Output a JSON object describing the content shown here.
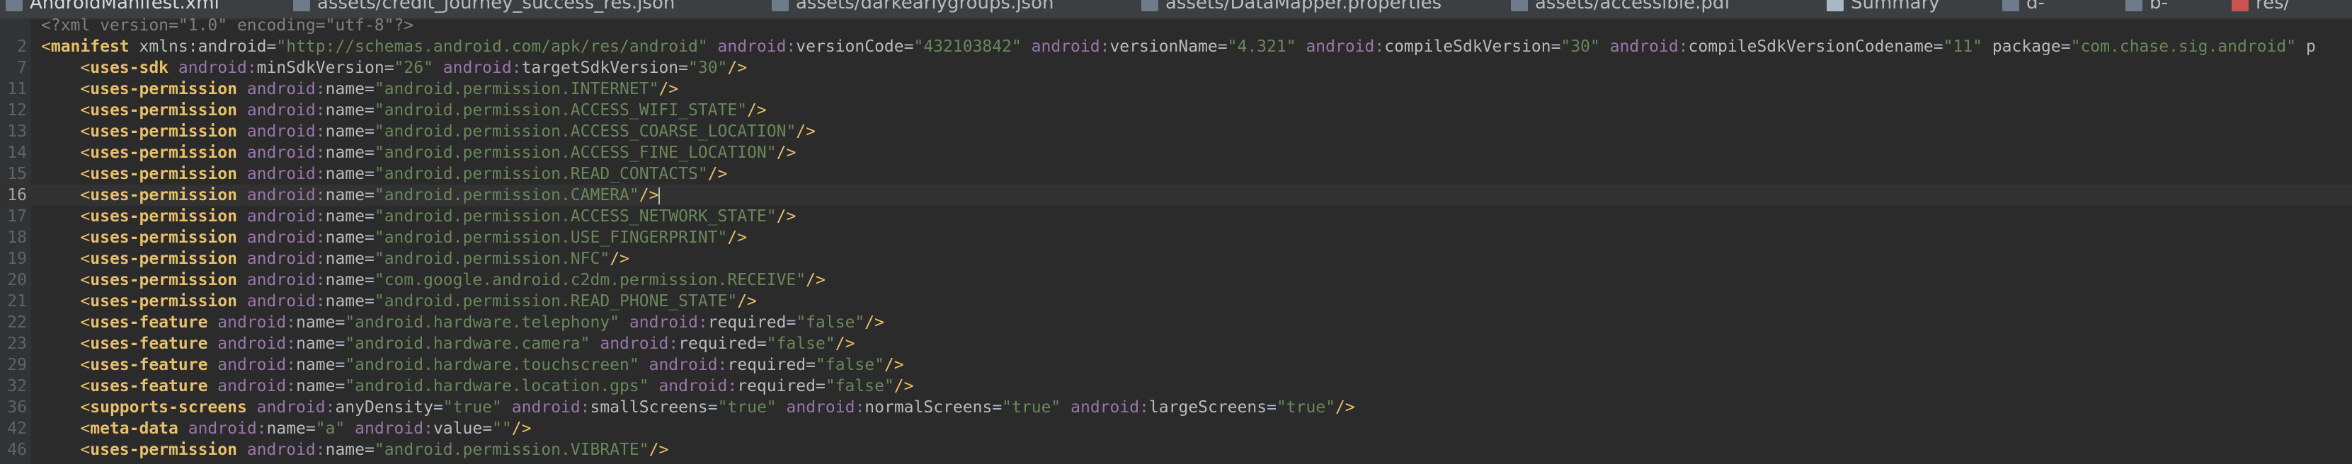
{
  "tabs": [
    {
      "label": "AndroidManifest.xml",
      "icon": "xml-file-icon",
      "active": true
    },
    {
      "label": "assets/credit_journey_success_res.json",
      "icon": "json-file-icon"
    },
    {
      "label": "assets/darkearlygroups.json",
      "icon": "json-file-icon"
    },
    {
      "label": "assets/DataMapper.properties",
      "icon": "properties-file-icon"
    },
    {
      "label": "assets/accessible.pdf",
      "icon": "pdf-file-icon"
    },
    {
      "label": "Summary",
      "icon": "summary-icon"
    },
    {
      "label": "d-",
      "icon": "file-icon"
    },
    {
      "label": "b-",
      "icon": "file-icon"
    },
    {
      "label": "res/",
      "icon": "res-folder-icon"
    }
  ],
  "lines": [
    {
      "num": "",
      "tokens": [
        [
          "decl",
          "<?xml version=\"1.0\" encoding=\"utf-8\"?>"
        ]
      ]
    },
    {
      "num": "2",
      "tokens": [
        [
          "brk",
          "<"
        ],
        [
          "tag",
          "manifest"
        ],
        [
          "txt",
          " "
        ],
        [
          "attr",
          "xmlns:android"
        ],
        [
          "eq",
          "="
        ],
        [
          "val",
          "\"http://schemas.android.com/apk/res/android\""
        ],
        [
          "txt",
          " "
        ],
        [
          "ns",
          "android:"
        ],
        [
          "attr",
          "versionCode"
        ],
        [
          "eq",
          "="
        ],
        [
          "val",
          "\"432103842\""
        ],
        [
          "txt",
          " "
        ],
        [
          "ns",
          "android:"
        ],
        [
          "attr",
          "versionName"
        ],
        [
          "eq",
          "="
        ],
        [
          "val",
          "\"4.321\""
        ],
        [
          "txt",
          " "
        ],
        [
          "ns",
          "android:"
        ],
        [
          "attr",
          "compileSdkVersion"
        ],
        [
          "eq",
          "="
        ],
        [
          "val",
          "\"30\""
        ],
        [
          "txt",
          " "
        ],
        [
          "ns",
          "android:"
        ],
        [
          "attr",
          "compileSdkVersionCodename"
        ],
        [
          "eq",
          "="
        ],
        [
          "val",
          "\"11\""
        ],
        [
          "txt",
          " "
        ],
        [
          "attr",
          "package"
        ],
        [
          "eq",
          "="
        ],
        [
          "val",
          "\"com.chase.sig.android\""
        ],
        [
          "txt",
          " p"
        ]
      ]
    },
    {
      "num": "7",
      "tokens": [
        [
          "txt",
          "    "
        ],
        [
          "brk",
          "<"
        ],
        [
          "tag",
          "uses-sdk"
        ],
        [
          "txt",
          " "
        ],
        [
          "ns",
          "android:"
        ],
        [
          "attr",
          "minSdkVersion"
        ],
        [
          "eq",
          "="
        ],
        [
          "val",
          "\"26\""
        ],
        [
          "txt",
          " "
        ],
        [
          "ns",
          "android:"
        ],
        [
          "attr",
          "targetSdkVersion"
        ],
        [
          "eq",
          "="
        ],
        [
          "val",
          "\"30\""
        ],
        [
          "brk",
          "/>"
        ]
      ]
    },
    {
      "num": "11",
      "tokens": [
        [
          "txt",
          "    "
        ],
        [
          "brk",
          "<"
        ],
        [
          "tag",
          "uses-permission"
        ],
        [
          "txt",
          " "
        ],
        [
          "ns",
          "android:"
        ],
        [
          "attr",
          "name"
        ],
        [
          "eq",
          "="
        ],
        [
          "val",
          "\"android.permission.INTERNET\""
        ],
        [
          "brk",
          "/>"
        ]
      ]
    },
    {
      "num": "12",
      "tokens": [
        [
          "txt",
          "    "
        ],
        [
          "brk",
          "<"
        ],
        [
          "tag",
          "uses-permission"
        ],
        [
          "txt",
          " "
        ],
        [
          "ns",
          "android:"
        ],
        [
          "attr",
          "name"
        ],
        [
          "eq",
          "="
        ],
        [
          "val",
          "\"android.permission.ACCESS_WIFI_STATE\""
        ],
        [
          "brk",
          "/>"
        ]
      ]
    },
    {
      "num": "13",
      "tokens": [
        [
          "txt",
          "    "
        ],
        [
          "brk",
          "<"
        ],
        [
          "tag",
          "uses-permission"
        ],
        [
          "txt",
          " "
        ],
        [
          "ns",
          "android:"
        ],
        [
          "attr",
          "name"
        ],
        [
          "eq",
          "="
        ],
        [
          "val",
          "\"android.permission.ACCESS_COARSE_LOCATION\""
        ],
        [
          "brk",
          "/>"
        ]
      ]
    },
    {
      "num": "14",
      "tokens": [
        [
          "txt",
          "    "
        ],
        [
          "brk",
          "<"
        ],
        [
          "tag",
          "uses-permission"
        ],
        [
          "txt",
          " "
        ],
        [
          "ns",
          "android:"
        ],
        [
          "attr",
          "name"
        ],
        [
          "eq",
          "="
        ],
        [
          "val",
          "\"android.permission.ACCESS_FINE_LOCATION\""
        ],
        [
          "brk",
          "/>"
        ]
      ]
    },
    {
      "num": "15",
      "tokens": [
        [
          "txt",
          "    "
        ],
        [
          "brk",
          "<"
        ],
        [
          "tag",
          "uses-permission"
        ],
        [
          "txt",
          " "
        ],
        [
          "ns",
          "android:"
        ],
        [
          "attr",
          "name"
        ],
        [
          "eq",
          "="
        ],
        [
          "val",
          "\"android.permission.READ_CONTACTS\""
        ],
        [
          "brk",
          "/>"
        ]
      ]
    },
    {
      "num": "16",
      "current": true,
      "tokens": [
        [
          "txt",
          "    "
        ],
        [
          "brk",
          "<"
        ],
        [
          "tag",
          "uses-permission"
        ],
        [
          "txt",
          " "
        ],
        [
          "ns",
          "android:"
        ],
        [
          "attr",
          "name"
        ],
        [
          "eq",
          "="
        ],
        [
          "val",
          "\"android.permission.CAMERA\""
        ],
        [
          "brk",
          "/>"
        ],
        [
          "caret",
          ""
        ]
      ]
    },
    {
      "num": "17",
      "tokens": [
        [
          "txt",
          "    "
        ],
        [
          "brk",
          "<"
        ],
        [
          "tag",
          "uses-permission"
        ],
        [
          "txt",
          " "
        ],
        [
          "ns",
          "android:"
        ],
        [
          "attr",
          "name"
        ],
        [
          "eq",
          "="
        ],
        [
          "val",
          "\"android.permission.ACCESS_NETWORK_STATE\""
        ],
        [
          "brk",
          "/>"
        ]
      ]
    },
    {
      "num": "18",
      "tokens": [
        [
          "txt",
          "    "
        ],
        [
          "brk",
          "<"
        ],
        [
          "tag",
          "uses-permission"
        ],
        [
          "txt",
          " "
        ],
        [
          "ns",
          "android:"
        ],
        [
          "attr",
          "name"
        ],
        [
          "eq",
          "="
        ],
        [
          "val",
          "\"android.permission.USE_FINGERPRINT\""
        ],
        [
          "brk",
          "/>"
        ]
      ]
    },
    {
      "num": "19",
      "tokens": [
        [
          "txt",
          "    "
        ],
        [
          "brk",
          "<"
        ],
        [
          "tag",
          "uses-permission"
        ],
        [
          "txt",
          " "
        ],
        [
          "ns",
          "android:"
        ],
        [
          "attr",
          "name"
        ],
        [
          "eq",
          "="
        ],
        [
          "val",
          "\"android.permission.NFC\""
        ],
        [
          "brk",
          "/>"
        ]
      ]
    },
    {
      "num": "20",
      "tokens": [
        [
          "txt",
          "    "
        ],
        [
          "brk",
          "<"
        ],
        [
          "tag",
          "uses-permission"
        ],
        [
          "txt",
          " "
        ],
        [
          "ns",
          "android:"
        ],
        [
          "attr",
          "name"
        ],
        [
          "eq",
          "="
        ],
        [
          "val",
          "\"com.google.android.c2dm.permission.RECEIVE\""
        ],
        [
          "brk",
          "/>"
        ]
      ]
    },
    {
      "num": "21",
      "tokens": [
        [
          "txt",
          "    "
        ],
        [
          "brk",
          "<"
        ],
        [
          "tag",
          "uses-permission"
        ],
        [
          "txt",
          " "
        ],
        [
          "ns",
          "android:"
        ],
        [
          "attr",
          "name"
        ],
        [
          "eq",
          "="
        ],
        [
          "val",
          "\"android.permission.READ_PHONE_STATE\""
        ],
        [
          "brk",
          "/>"
        ]
      ]
    },
    {
      "num": "22",
      "tokens": [
        [
          "txt",
          "    "
        ],
        [
          "brk",
          "<"
        ],
        [
          "tag",
          "uses-feature"
        ],
        [
          "txt",
          " "
        ],
        [
          "ns",
          "android:"
        ],
        [
          "attr",
          "name"
        ],
        [
          "eq",
          "="
        ],
        [
          "val",
          "\"android.hardware.telephony\""
        ],
        [
          "txt",
          " "
        ],
        [
          "ns",
          "android:"
        ],
        [
          "attr",
          "required"
        ],
        [
          "eq",
          "="
        ],
        [
          "val",
          "\"false\""
        ],
        [
          "brk",
          "/>"
        ]
      ]
    },
    {
      "num": "23",
      "tokens": [
        [
          "txt",
          "    "
        ],
        [
          "brk",
          "<"
        ],
        [
          "tag",
          "uses-feature"
        ],
        [
          "txt",
          " "
        ],
        [
          "ns",
          "android:"
        ],
        [
          "attr",
          "name"
        ],
        [
          "eq",
          "="
        ],
        [
          "val",
          "\"android.hardware.camera\""
        ],
        [
          "txt",
          " "
        ],
        [
          "ns",
          "android:"
        ],
        [
          "attr",
          "required"
        ],
        [
          "eq",
          "="
        ],
        [
          "val",
          "\"false\""
        ],
        [
          "brk",
          "/>"
        ]
      ]
    },
    {
      "num": "29",
      "tokens": [
        [
          "txt",
          "    "
        ],
        [
          "brk",
          "<"
        ],
        [
          "tag",
          "uses-feature"
        ],
        [
          "txt",
          " "
        ],
        [
          "ns",
          "android:"
        ],
        [
          "attr",
          "name"
        ],
        [
          "eq",
          "="
        ],
        [
          "val",
          "\"android.hardware.touchscreen\""
        ],
        [
          "txt",
          " "
        ],
        [
          "ns",
          "android:"
        ],
        [
          "attr",
          "required"
        ],
        [
          "eq",
          "="
        ],
        [
          "val",
          "\"false\""
        ],
        [
          "brk",
          "/>"
        ]
      ]
    },
    {
      "num": "32",
      "tokens": [
        [
          "txt",
          "    "
        ],
        [
          "brk",
          "<"
        ],
        [
          "tag",
          "uses-feature"
        ],
        [
          "txt",
          " "
        ],
        [
          "ns",
          "android:"
        ],
        [
          "attr",
          "name"
        ],
        [
          "eq",
          "="
        ],
        [
          "val",
          "\"android.hardware.location.gps\""
        ],
        [
          "txt",
          " "
        ],
        [
          "ns",
          "android:"
        ],
        [
          "attr",
          "required"
        ],
        [
          "eq",
          "="
        ],
        [
          "val",
          "\"false\""
        ],
        [
          "brk",
          "/>"
        ]
      ]
    },
    {
      "num": "36",
      "tokens": [
        [
          "txt",
          "    "
        ],
        [
          "brk",
          "<"
        ],
        [
          "tag",
          "supports-screens"
        ],
        [
          "txt",
          " "
        ],
        [
          "ns",
          "android:"
        ],
        [
          "attr",
          "anyDensity"
        ],
        [
          "eq",
          "="
        ],
        [
          "val",
          "\"true\""
        ],
        [
          "txt",
          " "
        ],
        [
          "ns",
          "android:"
        ],
        [
          "attr",
          "smallScreens"
        ],
        [
          "eq",
          "="
        ],
        [
          "val",
          "\"true\""
        ],
        [
          "txt",
          " "
        ],
        [
          "ns",
          "android:"
        ],
        [
          "attr",
          "normalScreens"
        ],
        [
          "eq",
          "="
        ],
        [
          "val",
          "\"true\""
        ],
        [
          "txt",
          " "
        ],
        [
          "ns",
          "android:"
        ],
        [
          "attr",
          "largeScreens"
        ],
        [
          "eq",
          "="
        ],
        [
          "val",
          "\"true\""
        ],
        [
          "brk",
          "/>"
        ]
      ]
    },
    {
      "num": "42",
      "tokens": [
        [
          "txt",
          "    "
        ],
        [
          "brk",
          "<"
        ],
        [
          "tag",
          "meta-data"
        ],
        [
          "txt",
          " "
        ],
        [
          "ns",
          "android:"
        ],
        [
          "attr",
          "name"
        ],
        [
          "eq",
          "="
        ],
        [
          "val",
          "\"a\""
        ],
        [
          "txt",
          " "
        ],
        [
          "ns",
          "android:"
        ],
        [
          "attr",
          "value"
        ],
        [
          "eq",
          "="
        ],
        [
          "val",
          "\"\""
        ],
        [
          "brk",
          "/>"
        ]
      ]
    },
    {
      "num": "46",
      "tokens": [
        [
          "txt",
          "    "
        ],
        [
          "brk",
          "<"
        ],
        [
          "tag",
          "uses-permission"
        ],
        [
          "txt",
          " "
        ],
        [
          "ns",
          "android:"
        ],
        [
          "attr",
          "name"
        ],
        [
          "eq",
          "="
        ],
        [
          "val",
          "\"android.permission.VIBRATE\""
        ],
        [
          "brk",
          "/>"
        ]
      ]
    }
  ]
}
